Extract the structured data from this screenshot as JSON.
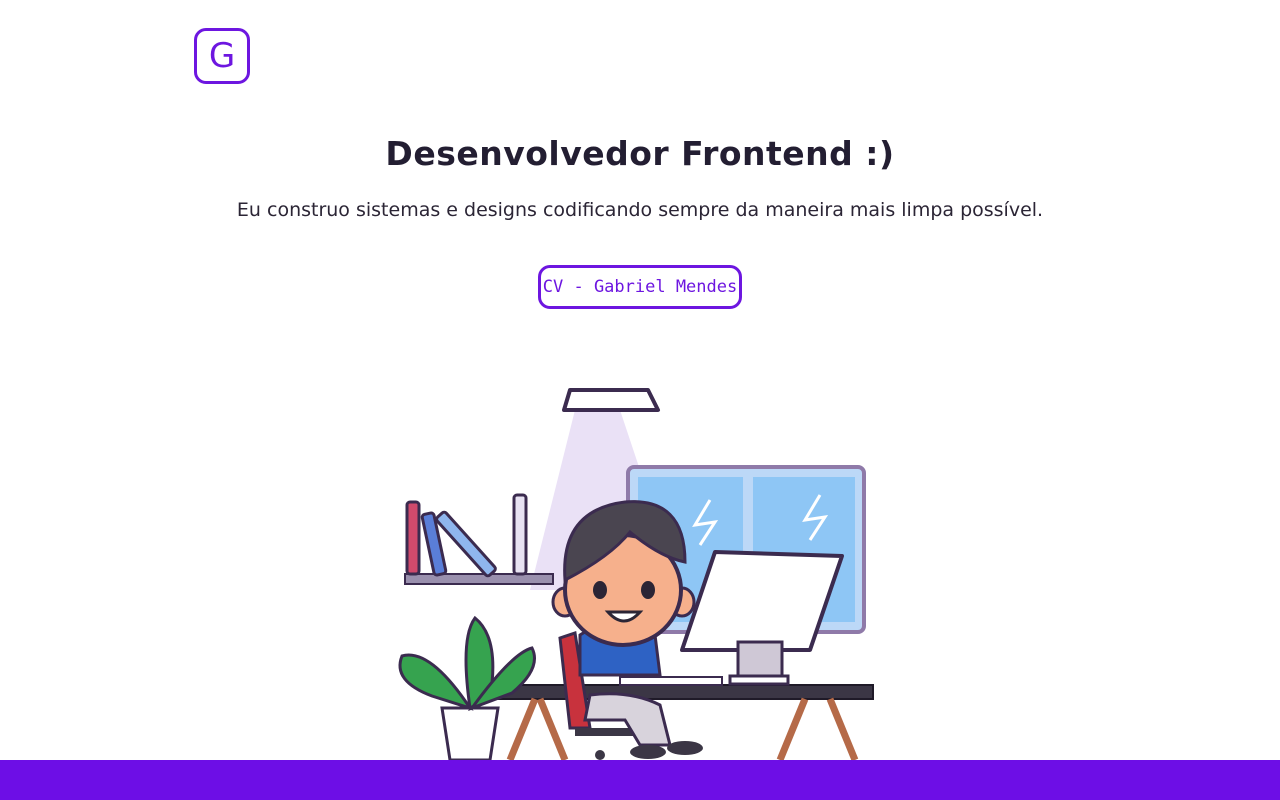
{
  "header": {
    "logo_letter": "G"
  },
  "hero": {
    "title": "Desenvolvedor Frontend :)",
    "subtitle": "Eu construo sistemas e designs codificando sempre da maneira mais limpa possível.",
    "cv_button_label": "CV - Gabriel Mendes"
  },
  "colors": {
    "accent": "#6d16e0",
    "footer": "#6d0ee6",
    "text": "#231e32"
  },
  "illustration": {
    "name": "developer-at-desk-illustration"
  }
}
